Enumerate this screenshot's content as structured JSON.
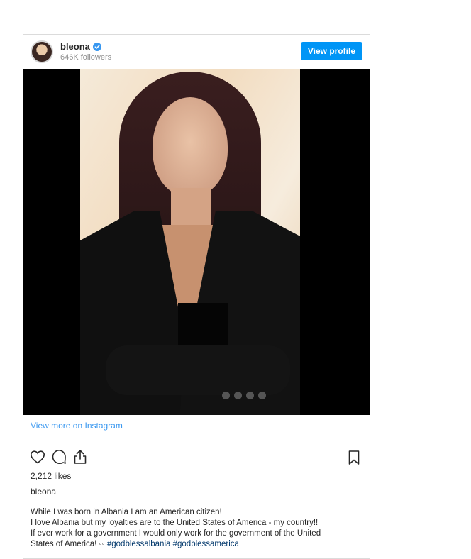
{
  "post": {
    "username": "bleona",
    "followers": "646K followers",
    "view_profile_label": "View profile",
    "view_more_label": "View more on Instagram",
    "likes": "2,212 likes",
    "caption_username": "bleona",
    "caption_lines": [
      "While I was born in Albania I am an American citizen!",
      "I love Albania but my loyalties are to the United States of America - my country!!",
      "If ever work for a government I would only work for the government of the United"
    ],
    "caption_last_prefix": "States of America! ◦◦ ",
    "hashtags": [
      "#godblessalbania",
      "#godblessamerica"
    ]
  },
  "icons": {
    "verified": "verified-badge-icon",
    "like": "heart-icon",
    "comment": "comment-icon",
    "share": "share-icon",
    "save": "bookmark-icon"
  },
  "colors": {
    "accent": "#0095f6",
    "link": "#3897f0",
    "verified": "#3897f0"
  }
}
